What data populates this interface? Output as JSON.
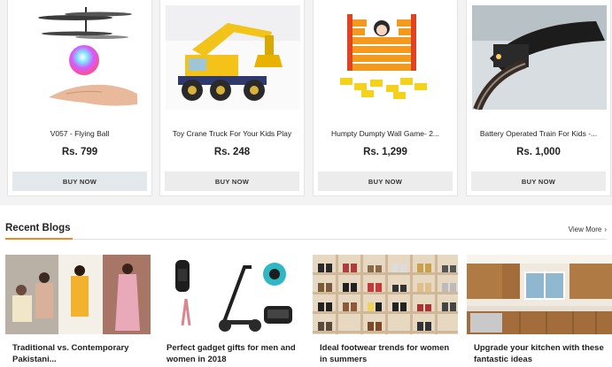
{
  "products": [
    {
      "name": "V057 - Flying Ball",
      "price": "Rs. 799",
      "button": "BUY NOW",
      "image": "flying-ball-image"
    },
    {
      "name": "Toy Crane Truck For Your Kids Play",
      "price": "Rs. 248",
      "button": "BUY NOW",
      "image": "crane-truck-image"
    },
    {
      "name": "Humpty Dumpty Wall Game- 2...",
      "price": "Rs. 1,299",
      "button": "BUY NOW",
      "image": "wall-game-image"
    },
    {
      "name": "Battery Operated Train For Kids -...",
      "price": "Rs. 1,000",
      "button": "BUY NOW",
      "image": "toy-train-image"
    }
  ],
  "blogs_section": {
    "title": "Recent Blogs",
    "view_more": "View More"
  },
  "blogs": [
    {
      "title": "Traditional vs. Contemporary Pakistani...",
      "image": "clothing-models-image"
    },
    {
      "title": "Perfect gadget gifts for men and women in 2018",
      "image": "gadgets-image"
    },
    {
      "title": "Ideal footwear trends for women in summers",
      "image": "shoe-rack-image"
    },
    {
      "title": "Upgrade your kitchen with these fantastic ideas",
      "image": "kitchen-image"
    }
  ],
  "colors": {
    "accent": "#f08a1c",
    "button_bg": "#ececec",
    "page_bg": "#f3f3f3"
  }
}
